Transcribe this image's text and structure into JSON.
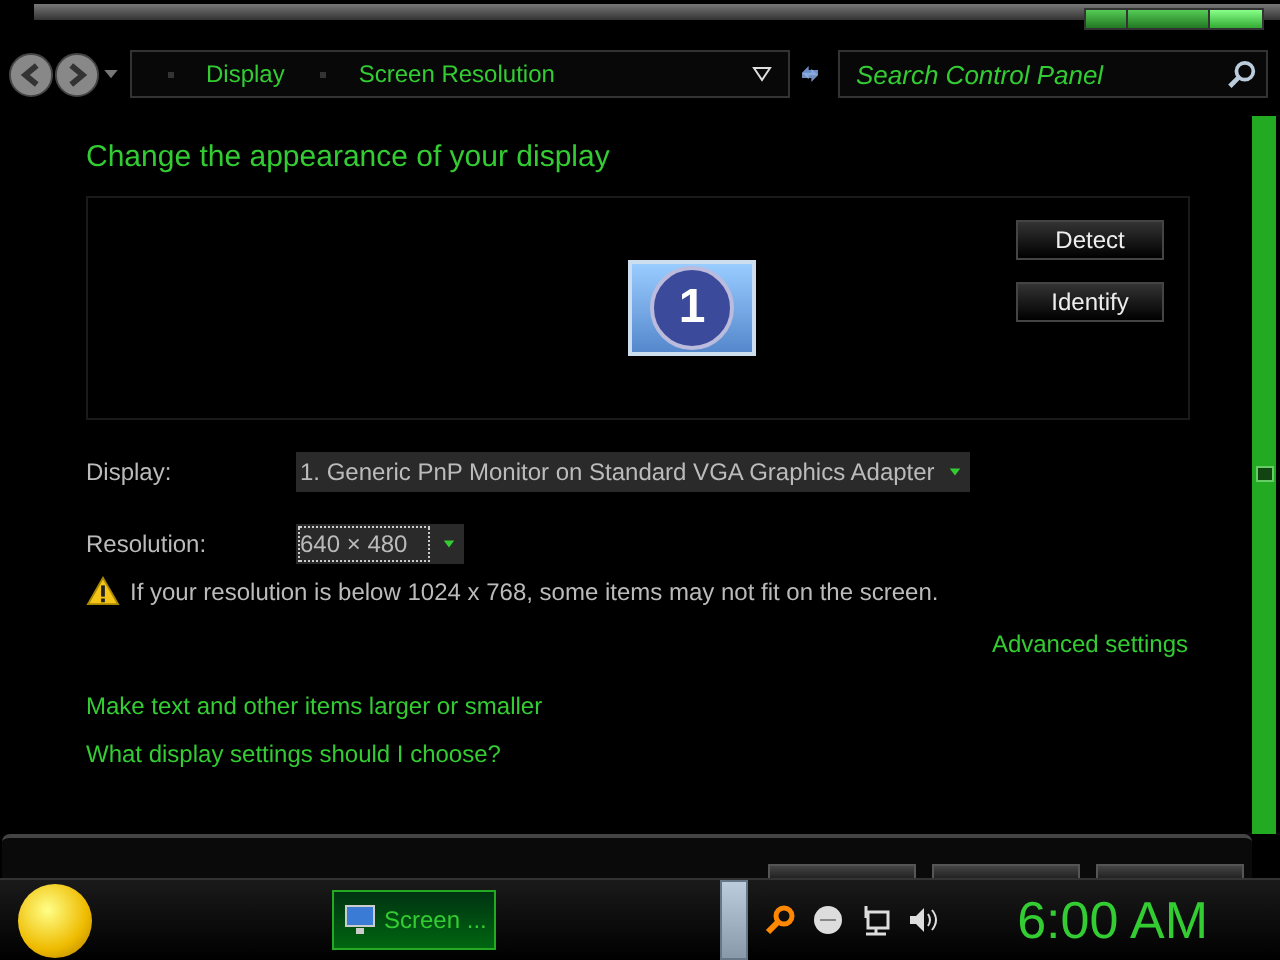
{
  "breadcrumb": {
    "items": [
      "Display",
      "Screen Resolution"
    ]
  },
  "search": {
    "placeholder": "Search Control Panel"
  },
  "heading": "Change the appearance of your display",
  "monitor": {
    "number": "1",
    "buttons": [
      "Detect",
      "Identify"
    ]
  },
  "fields": [
    {
      "label": "Display:",
      "value": "1. Generic PnP Monitor on Standard VGA Graphics Adapter",
      "focused": false
    },
    {
      "label": "Resolution:",
      "value": "640 × 480",
      "focused": true
    }
  ],
  "warning": "If your resolution is below 1024 x 768, some items may not fit on the screen.",
  "advanced_link": "Advanced settings",
  "links": [
    "Make text and other items larger or smaller",
    "What display settings should I choose?"
  ],
  "taskbar": {
    "task": "Screen ...",
    "clock": "6:00 AM"
  }
}
